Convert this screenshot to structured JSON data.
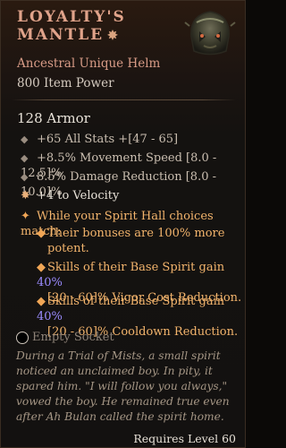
{
  "item": {
    "name_line1": "Loyalty's",
    "name_line2": "Mantle",
    "subtitle": "Ancestral Unique Helm",
    "power": "800 Item Power",
    "armor": "128 Armor"
  },
  "stats": [
    {
      "text": "+65 All Stats +[47 - 65]"
    },
    {
      "text": "+8.5% Movement Speed [8.0 - 12.5]%"
    },
    {
      "text": "8.5% Damage Reduction [8.0 - 10.0]%"
    },
    {
      "text": "+4 to Velocity"
    }
  ],
  "unique_power": {
    "intro": "While your Spirit Hall choices match:",
    "line1a": "Their bonuses are 100% more",
    "line1b": "potent.",
    "line2a": "Skills of their Base Spirit gain",
    "line2_value": "40%",
    "line2b": "[20 - 60]% Vigor Cost Reduction.",
    "line3a": "Skills of their Base Spirit gain",
    "line3_value": "40%",
    "line3b": "[20 - 60]% Cooldown Reduction."
  },
  "socket": "Empty Socket",
  "lore": "During a Trial of Mists, a small spirit noticed an unclaimed boy. In pity, it spared him. \"I will follow you always,\" vowed the boy. He remained true even after Ah Bulan called the spirit home.",
  "requirement": "Requires Level 60",
  "colors": {
    "title": "#e0a38a",
    "unique_text": "#f3b46c",
    "highlight": "#9c8cff"
  },
  "icons": [
    "unique-star-icon",
    "helm-icon",
    "bullet-diamond-icon",
    "velocity-star-icon",
    "unique-bullet-icon",
    "socket-icon"
  ]
}
